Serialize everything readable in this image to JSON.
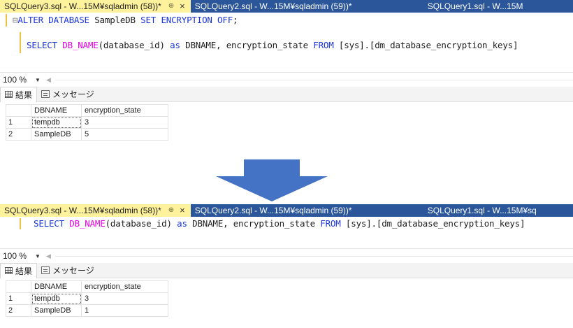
{
  "panels": [
    {
      "id": "before",
      "tabs": [
        {
          "label": "SQLQuery3.sql - W...15M¥sqladmin (58))*",
          "pin": "⊕",
          "close": "×",
          "active": true
        },
        {
          "label": "SQLQuery2.sql - W...15M¥sqladmin (59))*",
          "active": false
        },
        {
          "label": "SQLQuery1.sql - W...15M",
          "active": false
        }
      ],
      "code": {
        "line1_prefix": "⊟",
        "line1_kw": "ALTER DATABASE",
        "line1_plain": " SampleDB ",
        "line1_kw2": "SET ENCRYPTION OFF",
        "line1_end": ";",
        "line2_kw": "SELECT",
        "line2_fn": "DB_NAME",
        "line2_arg": "(database_id)",
        "line2_as": "as",
        "line2_alias": "DBNAME, encryption_state",
        "line2_from": "FROM",
        "line2_table": "[sys].[dm_database_encryption_keys]"
      },
      "zoom": "100 %",
      "result_tabs": {
        "results": "結果",
        "messages": "メッセージ"
      },
      "columns": [
        "DBNAME",
        "encryption_state"
      ],
      "rows": [
        {
          "num": "1",
          "dbname": "tempdb",
          "state": "3"
        },
        {
          "num": "2",
          "dbname": "SampleDB",
          "state": "5"
        }
      ]
    },
    {
      "id": "after",
      "tabs": [
        {
          "label": "SQLQuery3.sql - W...15M¥sqladmin (58))*",
          "pin": "⊕",
          "close": "×",
          "active": true
        },
        {
          "label": "SQLQuery2.sql - W...15M¥sqladmin (59))*",
          "active": false
        },
        {
          "label": "SQLQuery1.sql - W...15M¥sq",
          "active": false
        }
      ],
      "code": {
        "line2_kw": "SELECT",
        "line2_fn": "DB_NAME",
        "line2_arg": "(database_id)",
        "line2_as": "as",
        "line2_alias": "DBNAME, encryption_state",
        "line2_from": "FROM",
        "line2_table": "[sys].[dm_database_encryption_keys]"
      },
      "zoom": "100 %",
      "result_tabs": {
        "results": "結果",
        "messages": "メッセージ"
      },
      "columns": [
        "DBNAME",
        "encryption_state"
      ],
      "rows": [
        {
          "num": "1",
          "dbname": "tempdb",
          "state": "3"
        },
        {
          "num": "2",
          "dbname": "SampleDB",
          "state": "1"
        }
      ]
    }
  ],
  "arrow": {
    "direction": "down",
    "color": "#4472c4"
  },
  "colors": {
    "tab_bar": "#2b579a",
    "active_tab": "#fff29d",
    "keyword": "#1b34d8",
    "function": "#e100e1"
  }
}
